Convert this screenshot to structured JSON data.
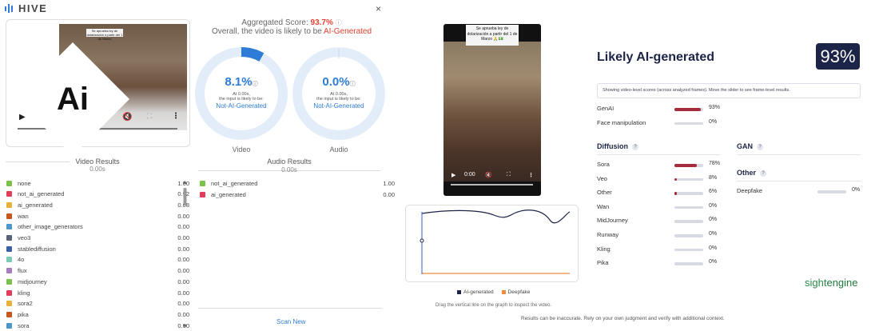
{
  "hive": {
    "brand": "HIVE",
    "close": "×",
    "aggregated_label": "Aggregated Score:",
    "aggregated_value": "93.7%",
    "overall_prefix": "Overall, the video is likely to be",
    "overall_verdict": "AI-Generated",
    "video_caption": "Se aprueba ley de dolarización a partir del 1 de Marzo",
    "video_gauge": {
      "pct": "8.1%",
      "fraction": 0.081,
      "time": "At 0.00s,",
      "desc": "the input is likely to be:",
      "verdict": "Not-AI-Generated",
      "caption": "Video"
    },
    "audio_gauge": {
      "pct": "0.0%",
      "fraction": 0.0,
      "time": "At 0.00s,",
      "desc": "the input is likely to be:",
      "verdict": "Not-AI-Generated",
      "caption": "Audio"
    },
    "video_results_title": "Video Results",
    "video_results_time": "0.00s",
    "audio_results_title": "Audio Results",
    "audio_results_time": "0.00s",
    "video_results": [
      {
        "name": "none",
        "value": "1.00",
        "color": "#7cc24a"
      },
      {
        "name": "not_ai_generated",
        "value": "0.92",
        "color": "#e23d5a"
      },
      {
        "name": "ai_generated",
        "value": "0.08",
        "color": "#e8b23a"
      },
      {
        "name": "wan",
        "value": "0.00",
        "color": "#c9561f"
      },
      {
        "name": "other_image_generators",
        "value": "0.00",
        "color": "#4a97c9"
      },
      {
        "name": "veo3",
        "value": "0.00",
        "color": "#5a6478"
      },
      {
        "name": "stablediffusion",
        "value": "0.00",
        "color": "#3d5fa6"
      },
      {
        "name": "4o",
        "value": "0.00",
        "color": "#7dc9b7"
      },
      {
        "name": "flux",
        "value": "0.00",
        "color": "#a87dc0"
      },
      {
        "name": "midjourney",
        "value": "0.00",
        "color": "#7cc24a"
      },
      {
        "name": "kling",
        "value": "0.00",
        "color": "#e23d5a"
      },
      {
        "name": "sora2",
        "value": "0.00",
        "color": "#e8b23a"
      },
      {
        "name": "pika",
        "value": "0.00",
        "color": "#c9561f"
      },
      {
        "name": "sora",
        "value": "0.00",
        "color": "#4a97c9"
      }
    ],
    "audio_results": [
      {
        "name": "not_ai_generated",
        "value": "1.00",
        "color": "#7cc24a"
      },
      {
        "name": "ai_generated",
        "value": "0.00",
        "color": "#e23d5a"
      }
    ],
    "scan_new": "Scan New"
  },
  "sightengine": {
    "video_caption": "Se aprueba ley de dolarización a partir del 1 de Marzo 🙏💵",
    "video_time": "0:00",
    "title": "Likely AI-generated",
    "badge": "93%",
    "note": "Showing video-level scores (across analyzed frames). Move the slider to see frame-level results.",
    "top_rows": [
      {
        "name": "GenAI",
        "pct": "93%",
        "fraction": 0.93
      },
      {
        "name": "Face manipulation",
        "pct": "0%",
        "fraction": 0.0
      }
    ],
    "diffusion_title": "Diffusion",
    "diffusion_rows": [
      {
        "name": "Sora",
        "pct": "78%",
        "fraction": 0.78
      },
      {
        "name": "Veo",
        "pct": "8%",
        "fraction": 0.08
      },
      {
        "name": "Other",
        "pct": "6%",
        "fraction": 0.06
      },
      {
        "name": "Wan",
        "pct": "0%",
        "fraction": 0.0
      },
      {
        "name": "MidJourney",
        "pct": "0%",
        "fraction": 0.0
      },
      {
        "name": "Runway",
        "pct": "0%",
        "fraction": 0.0
      },
      {
        "name": "Kling",
        "pct": "0%",
        "fraction": 0.0
      },
      {
        "name": "Pika",
        "pct": "0%",
        "fraction": 0.0
      }
    ],
    "gan_title": "GAN",
    "other_title": "Other",
    "other_rows": [
      {
        "name": "Deepfake",
        "pct": "0%",
        "fraction": 0.0
      }
    ],
    "legend": [
      {
        "name": "AI-generated",
        "color": "#1c2447"
      },
      {
        "name": "Deepfake",
        "color": "#f08a3a"
      }
    ],
    "drag_hint": "Drag the vertical line on the graph to inspect the video.",
    "disclaimer": "Results can be inaccurate. Rely on your own judgment and verify with additional context.",
    "brand_a": "sight",
    "brand_b": "engine"
  }
}
